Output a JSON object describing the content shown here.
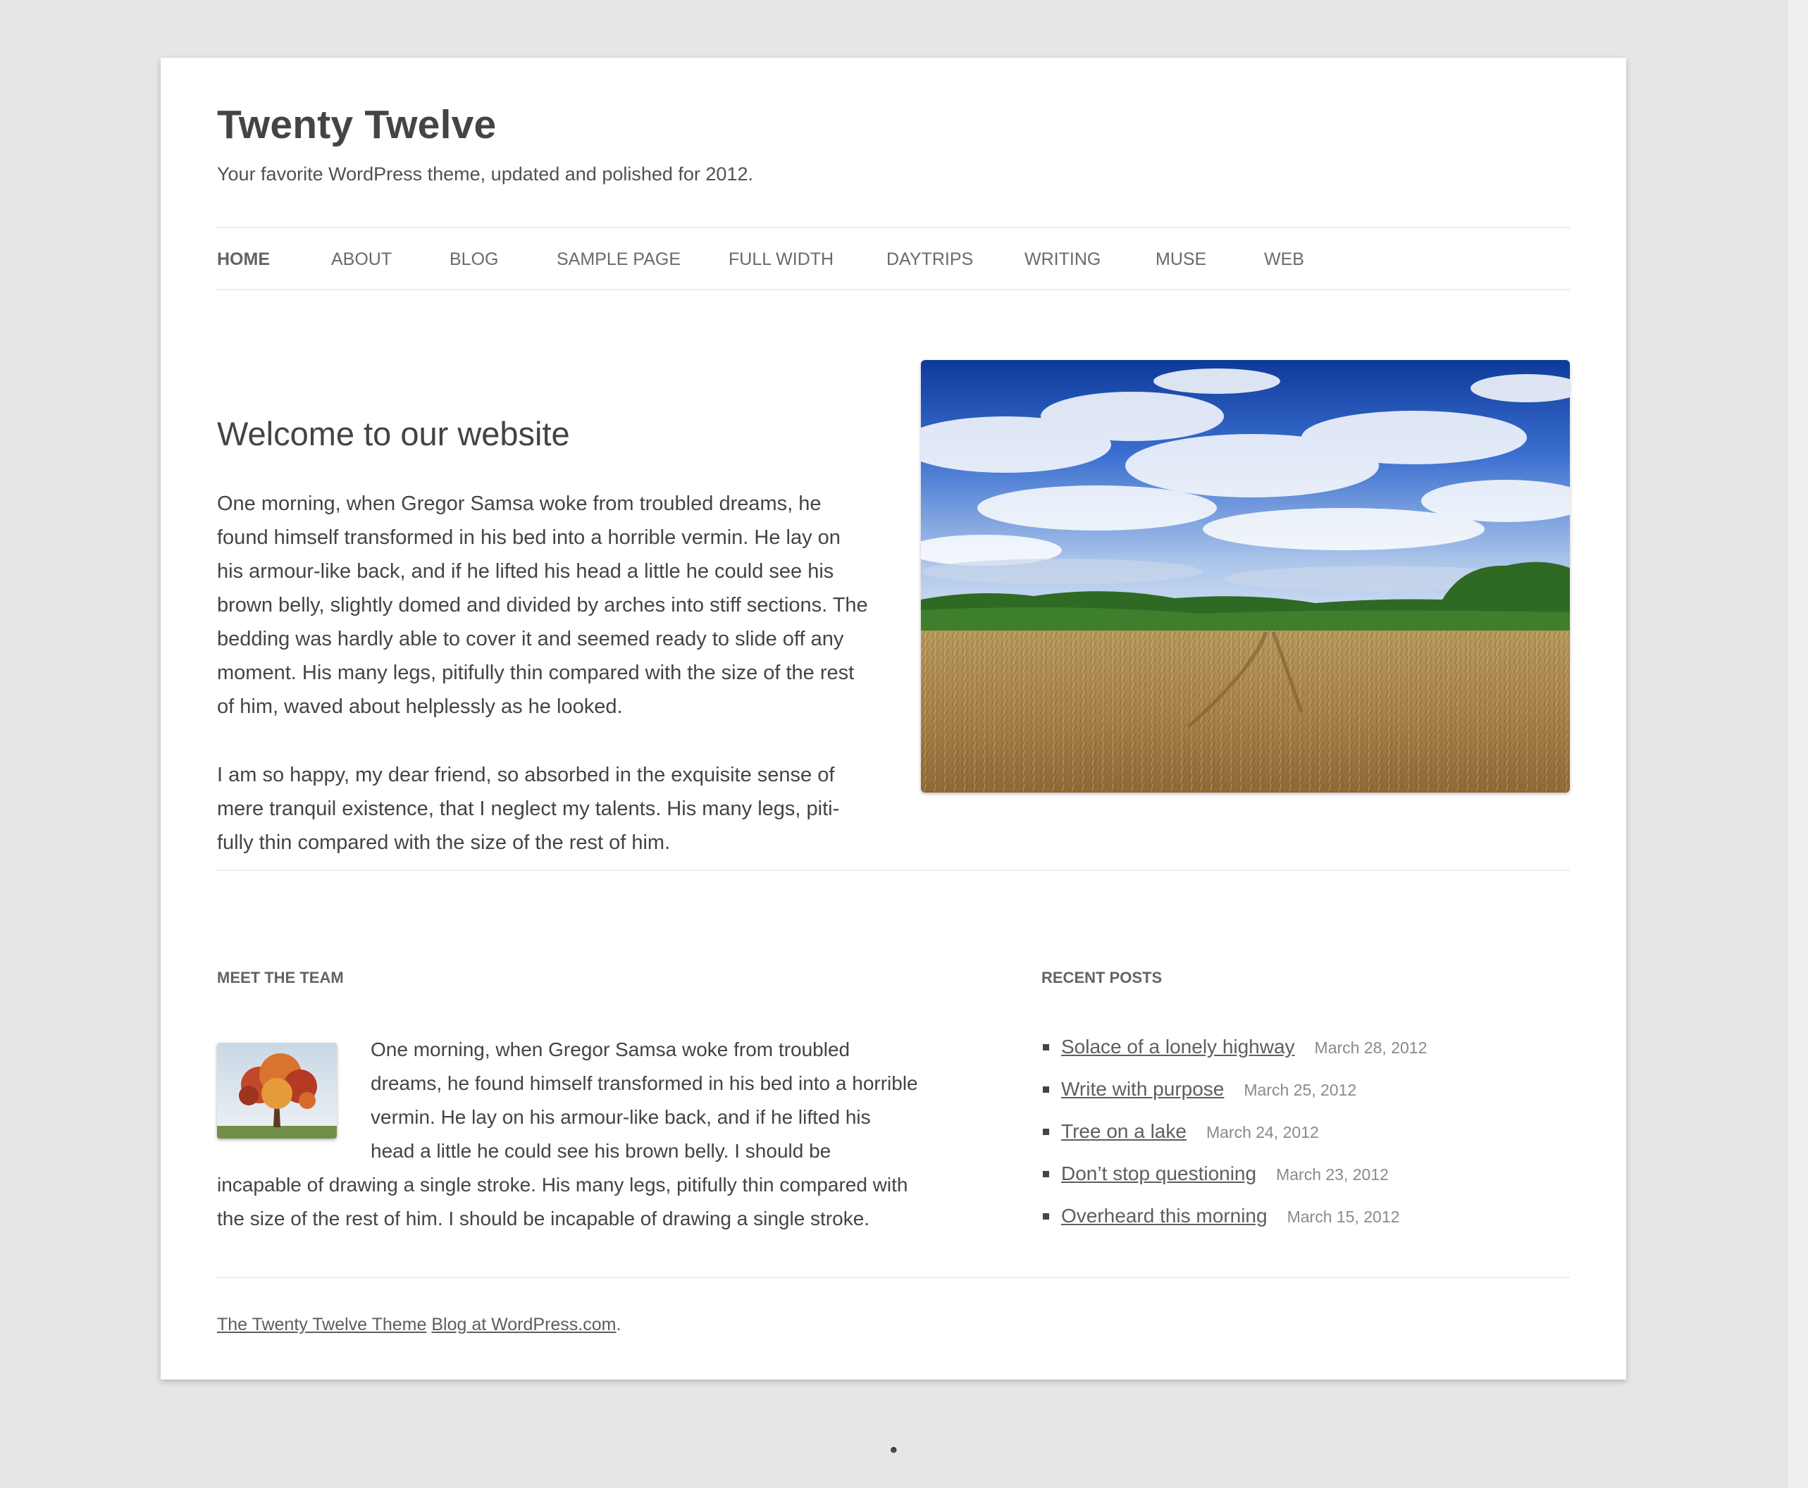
{
  "site": {
    "title": "Twenty Twelve",
    "description": "Your favorite WordPress theme, updated and polished for 2012."
  },
  "nav": {
    "items": [
      {
        "label": "HOME",
        "current": true
      },
      {
        "label": "ABOUT"
      },
      {
        "label": "BLOG"
      },
      {
        "label": "SAMPLE PAGE"
      },
      {
        "label": "FULL WIDTH"
      },
      {
        "label": "DAYTRIPS"
      },
      {
        "label": "WRITING"
      },
      {
        "label": "MUSE"
      },
      {
        "label": "WEB"
      }
    ]
  },
  "main": {
    "title": "Welcome to our website",
    "paragraphs": [
      "One morning, when Gregor Samsa woke from troubled dreams, he found himself transformed in his bed into a horrible vermin. He lay on his armour-like back, and if he lifted his head a little he could see his brown belly, slightly domed and divided by arches into stiff sections. The bedding was hardly able to cover it and seemed ready to slide off any moment. His many legs, pitifully thin compared with the size of the rest of him, waved about helplessly as he looked.",
      "I am so happy, my dear friend, so absorbed in the exquisite sense of mere tranquil existence, that I neglect my talents. His many legs, piti-fully thin compared with the size of the rest of him."
    ]
  },
  "team_widget": {
    "title": "MEET THE TEAM",
    "text": "One morning, when Gregor Samsa woke from troubled dreams, he found himself transformed in his bed into a horrible vermin. He lay on his armour-like back, and if he lifted his head a little he could see his brown belly. I should be incapable of drawing a single stroke. His many legs, pitifully thin compared with the size of the rest of him. I should be incapable of drawing a single stroke."
  },
  "recent_posts": {
    "title": "RECENT POSTS",
    "items": [
      {
        "title": "Solace of a lonely highway",
        "date": "March 28, 2012"
      },
      {
        "title": "Write with purpose",
        "date": "March 25, 2012"
      },
      {
        "title": "Tree on a lake",
        "date": "March 24, 2012"
      },
      {
        "title": "Don’t stop questioning",
        "date": "March 23, 2012"
      },
      {
        "title": "Overheard this morning",
        "date": "March 15, 2012"
      }
    ]
  },
  "footer": {
    "theme_link": "The Twenty Twelve Theme",
    "wp_link": "Blog at WordPress.com",
    "trailing": "."
  },
  "bottom": {
    "smiley": "☻"
  },
  "colors": {
    "page_background": "#e6e6e6",
    "content_background": "#ffffff",
    "text": "#444444",
    "meta_text": "#8a8a8a"
  }
}
